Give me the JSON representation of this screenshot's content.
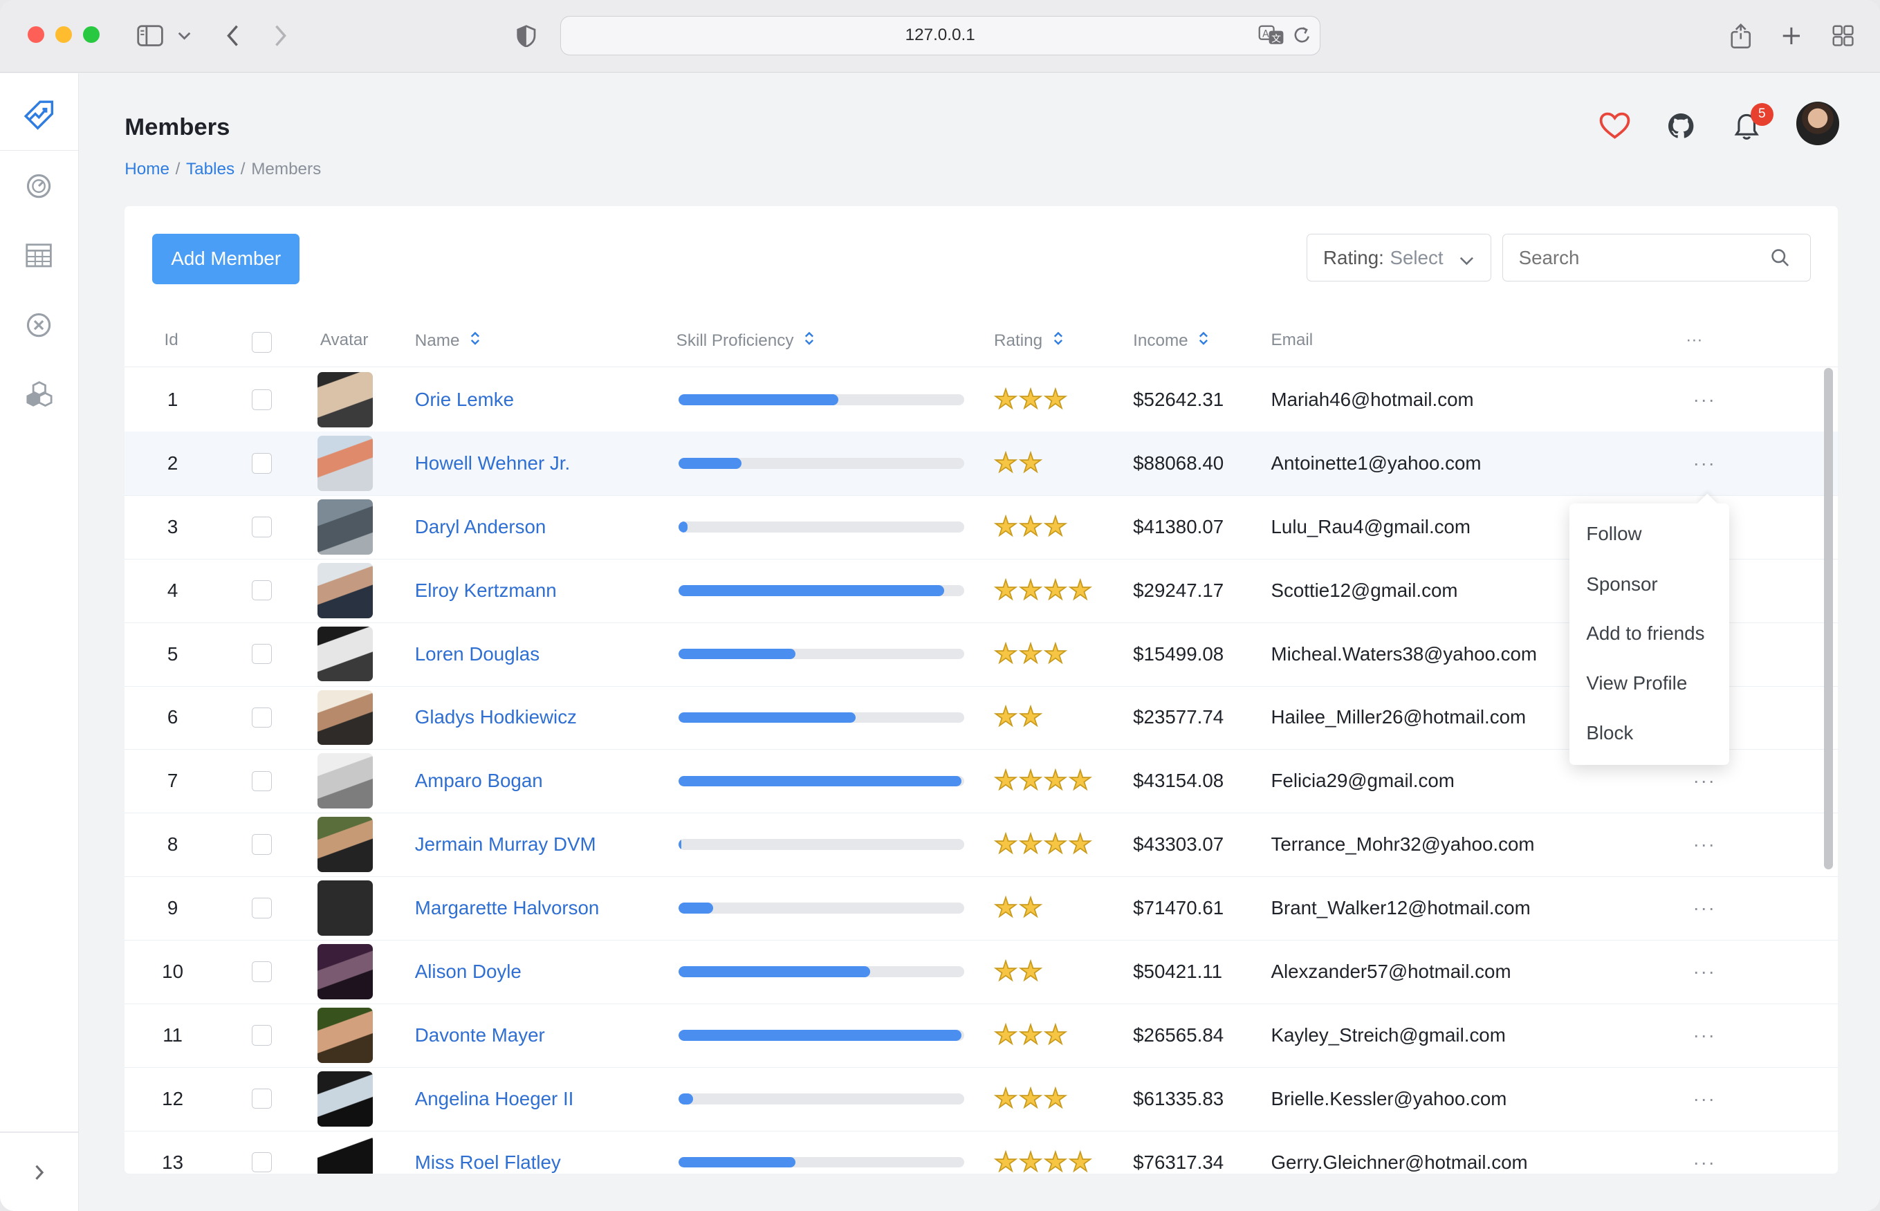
{
  "browser": {
    "url": "127.0.0.1"
  },
  "page": {
    "title": "Members"
  },
  "breadcrumb": [
    {
      "label": "Home"
    },
    {
      "label": "Tables"
    },
    {
      "label": "Members"
    }
  ],
  "header": {
    "notifications_count": "5"
  },
  "toolbar": {
    "add_label": "Add Member",
    "rating_label": "Rating:",
    "rating_value": "Select",
    "search_placeholder": "Search"
  },
  "table": {
    "columns": [
      "Id",
      "Avatar",
      "Name",
      "Skill Proficiency",
      "Rating",
      "Income",
      "Email"
    ],
    "more_header": "···",
    "rows": [
      {
        "id": "1",
        "name": "Orie Lemke",
        "progress": 0.56,
        "rating": 3,
        "income": "$52642.31",
        "email": "Mariah46@hotmail.com"
      },
      {
        "id": "2",
        "name": "Howell Wehner Jr.",
        "progress": 0.22,
        "rating": 2,
        "income": "$88068.40",
        "email": "Antoinette1@yahoo.com"
      },
      {
        "id": "3",
        "name": "Daryl Anderson",
        "progress": 0.03,
        "rating": 3,
        "income": "$41380.07",
        "email": "Lulu_Rau4@gmail.com"
      },
      {
        "id": "4",
        "name": "Elroy Kertzmann",
        "progress": 0.93,
        "rating": 4,
        "income": "$29247.17",
        "email": "Scottie12@gmail.com"
      },
      {
        "id": "5",
        "name": "Loren Douglas",
        "progress": 0.41,
        "rating": 3,
        "income": "$15499.08",
        "email": "Micheal.Waters38@yahoo.com"
      },
      {
        "id": "6",
        "name": "Gladys Hodkiewicz",
        "progress": 0.62,
        "rating": 2,
        "income": "$23577.74",
        "email": "Hailee_Miller26@hotmail.com"
      },
      {
        "id": "7",
        "name": "Amparo Bogan",
        "progress": 0.99,
        "rating": 4,
        "income": "$43154.08",
        "email": "Felicia29@gmail.com"
      },
      {
        "id": "8",
        "name": "Jermain Murray DVM",
        "progress": 0.01,
        "rating": 4,
        "income": "$43303.07",
        "email": "Terrance_Mohr32@yahoo.com"
      },
      {
        "id": "9",
        "name": "Margarette Halvorson",
        "progress": 0.12,
        "rating": 2,
        "income": "$71470.61",
        "email": "Brant_Walker12@hotmail.com"
      },
      {
        "id": "10",
        "name": "Alison Doyle",
        "progress": 0.67,
        "rating": 2,
        "income": "$50421.11",
        "email": "Alexzander57@hotmail.com"
      },
      {
        "id": "11",
        "name": "Davonte Mayer",
        "progress": 0.99,
        "rating": 3,
        "income": "$26565.84",
        "email": "Kayley_Streich@gmail.com"
      },
      {
        "id": "12",
        "name": "Angelina Hoeger II",
        "progress": 0.05,
        "rating": 3,
        "income": "$61335.83",
        "email": "Brielle.Kessler@yahoo.com"
      },
      {
        "id": "13",
        "name": "Miss Roel Flatley",
        "progress": 0.41,
        "rating": 4,
        "income": "$76317.34",
        "email": "Gerry.Gleichner@hotmail.com"
      }
    ]
  },
  "row_menu": {
    "items": [
      "Follow",
      "Sponsor",
      "Add to friends",
      "View Profile",
      "Block"
    ]
  },
  "colors": {
    "accent": "#4a9ef5",
    "link": "#2f6fd1",
    "badge": "#e8402f",
    "heart": "#e8463a",
    "star": "#f6c544"
  }
}
